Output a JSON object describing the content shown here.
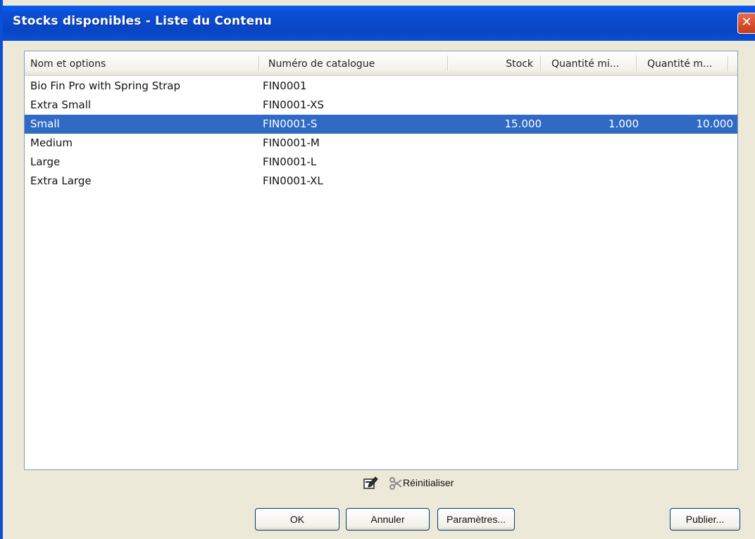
{
  "window": {
    "title": "Stocks disponibles - Liste du Contenu",
    "close_glyph": "✕"
  },
  "listview": {
    "columns": [
      {
        "label": "Nom et options"
      },
      {
        "label": "Numéro de catalogue"
      },
      {
        "label": "Stock"
      },
      {
        "label": "Quantité mi..."
      },
      {
        "label": "Quantité m..."
      }
    ],
    "rows": [
      {
        "name": "Bio Fin Pro with Spring Strap",
        "catalog": "FIN0001",
        "stock": "",
        "qmin": "",
        "qmax": "",
        "selected": false
      },
      {
        "name": "Extra Small",
        "catalog": "FIN0001-XS",
        "stock": "",
        "qmin": "",
        "qmax": "",
        "selected": false
      },
      {
        "name": "Small",
        "catalog": "FIN0001-S",
        "stock": "15.000",
        "qmin": "1.000",
        "qmax": "10.000",
        "selected": true
      },
      {
        "name": "Medium",
        "catalog": "FIN0001-M",
        "stock": "",
        "qmin": "",
        "qmax": "",
        "selected": false
      },
      {
        "name": "Large",
        "catalog": "FIN0001-L",
        "stock": "",
        "qmin": "",
        "qmax": "",
        "selected": false
      },
      {
        "name": "Extra Large",
        "catalog": "FIN0001-XL",
        "stock": "",
        "qmin": "",
        "qmax": "",
        "selected": false
      }
    ]
  },
  "toolbar": {
    "edit_icon": "edit-icon",
    "reset_icon": "scissors-icon",
    "reset_label": "Réinitialiser"
  },
  "buttons": {
    "ok": "OK",
    "cancel": "Annuler",
    "params": "Paramètres...",
    "publish": "Publier..."
  },
  "colors": {
    "titlebar": "#0a4fd6",
    "selection": "#316ac5",
    "dialog_bg": "#ece9d8",
    "close": "#c93a18"
  }
}
